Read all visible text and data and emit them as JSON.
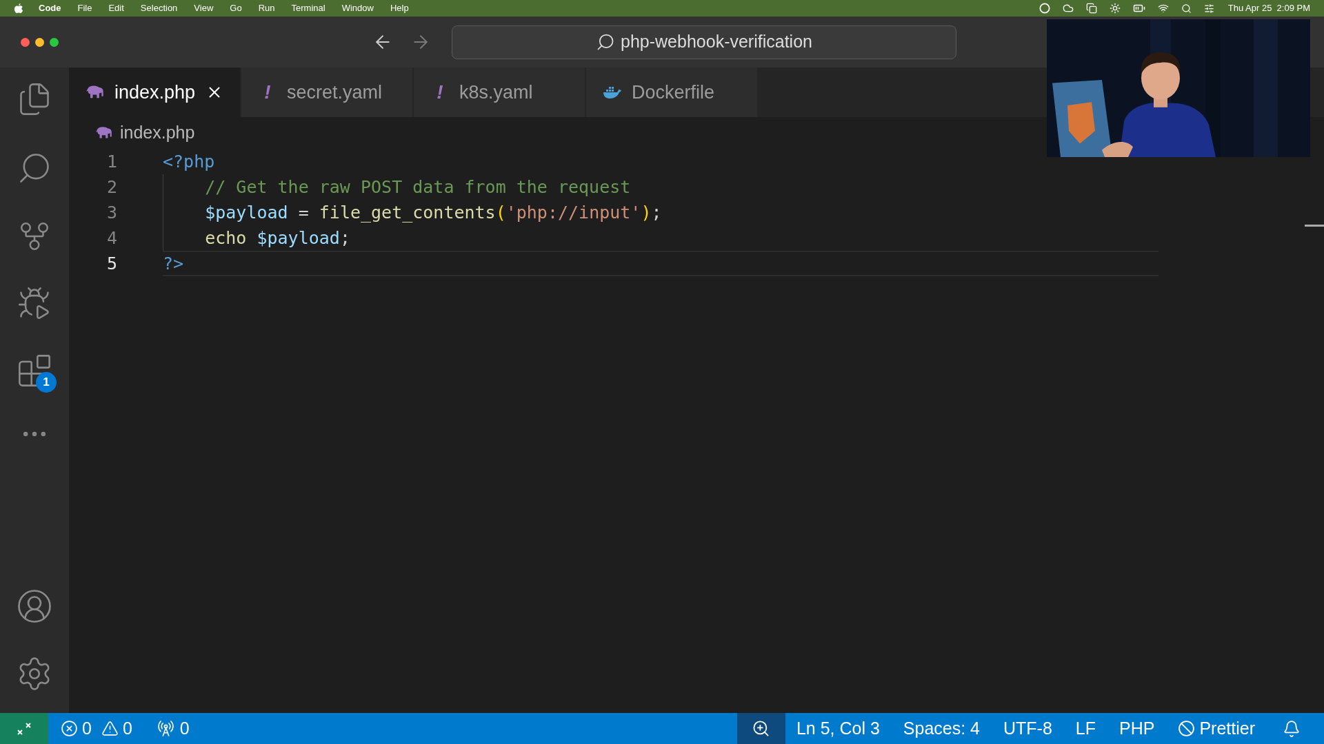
{
  "menu_bar": {
    "app": "Code",
    "items": [
      "File",
      "Edit",
      "Selection",
      "View",
      "Go",
      "Run",
      "Terminal",
      "Window",
      "Help"
    ],
    "clock": "Thu Apr 25  2:09 PM"
  },
  "title_bar": {
    "search": "php-webhook-verification"
  },
  "activity_bar": {
    "extensions_badge": "1"
  },
  "tabs": [
    {
      "label": "index.php",
      "kind": "php",
      "selected": true
    },
    {
      "label": "secret.yaml",
      "kind": "yaml",
      "mark": "!",
      "selected": false
    },
    {
      "label": "k8s.yaml",
      "kind": "yaml",
      "mark": "!",
      "selected": false
    },
    {
      "label": "Dockerfile",
      "kind": "docker",
      "selected": false
    }
  ],
  "breadcrumb": {
    "file": "index.php"
  },
  "editor": {
    "lines": [
      {
        "number": "1",
        "current": false,
        "tokens": [
          {
            "text": "<?php",
            "kind": "tag"
          }
        ]
      },
      {
        "number": "2",
        "current": false,
        "tokens": [
          {
            "text": "    // Get the raw POST data from the request",
            "kind": "comment"
          }
        ]
      },
      {
        "number": "3",
        "current": false,
        "tokens": [
          {
            "text": "    $payload",
            "kind": "variable"
          },
          {
            "text": " = ",
            "kind": "plain"
          },
          {
            "text": "file_get_contents",
            "kind": "function"
          },
          {
            "text": "(",
            "kind": "paren"
          },
          {
            "text": "'php://input'",
            "kind": "string"
          },
          {
            "text": ")",
            "kind": "paren"
          },
          {
            "text": ";",
            "kind": "plain"
          }
        ]
      },
      {
        "number": "4",
        "current": false,
        "tokens": [
          {
            "text": "    echo ",
            "kind": "function"
          },
          {
            "text": "$payload",
            "kind": "variable"
          },
          {
            "text": ";",
            "kind": "plain"
          }
        ]
      },
      {
        "number": "5",
        "current": true,
        "tokens": [
          {
            "text": "?>",
            "kind": "tag"
          }
        ]
      }
    ]
  },
  "status_bar": {
    "errors": "0",
    "warnings": "0",
    "ports": "0",
    "position": "Ln 5, Col 3",
    "spaces": "Spaces: 4",
    "encoding": "UTF-8",
    "eol": "LF",
    "language": "PHP",
    "formatter": "Prettier"
  }
}
